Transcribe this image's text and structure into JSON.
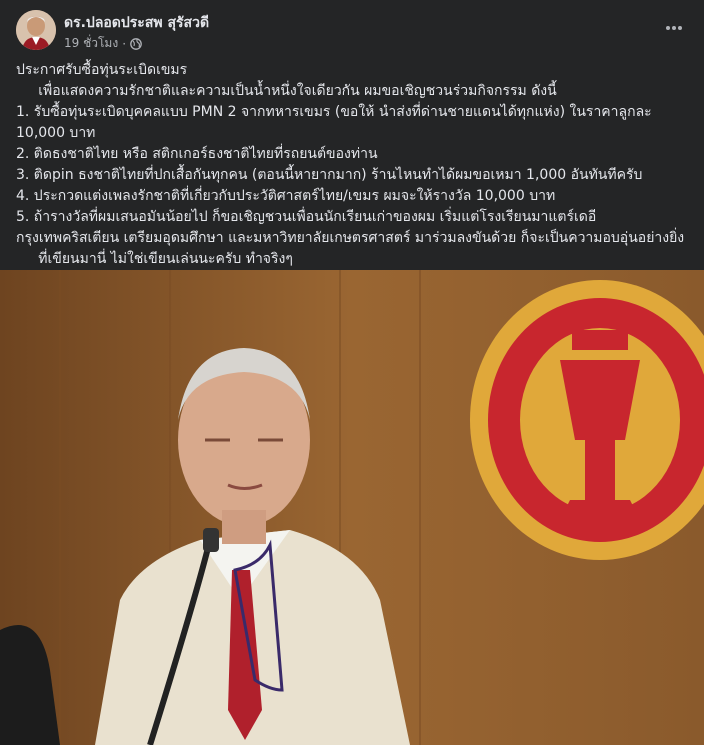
{
  "post": {
    "author": "ดร.ปลอดประสพ สุรัสวดี",
    "time": "19 ชั่วโมง",
    "separator": "·",
    "privacy_icon": "globe-icon",
    "more_icon": "ellipsis-icon",
    "lines": [
      "ประกาศรับซื้อทุ่นระเบิดเขมร",
      "     เพื่อแสดงความรักชาติและความเป็นน้ำหนึ่งใจเดียวกัน ผมขอเชิญชวนร่วมกิจกรรม ดังนี้",
      "1. รับซื้อทุ่นระเบิดบุคคลแบบ PMN 2 จากทหารเขมร (ขอให้ นำส่งที่ด่านชายแดนได้ทุกแห่ง) ในราคาลูกละ 10,000 บาท",
      "2. ติดธงชาติไทย หรือ สติกเกอร์ธงชาติไทยที่รถยนต์ของท่าน",
      "3. ติดpin ธงชาติไทยที่ปกเสื้อกันทุกคน (ตอนนี้หายากมาก) ร้านไหนทำได้ผมขอเหมา 1,000 อันทันทีครับ",
      "4. ประกวดแต่งเพลงรักชาติที่เกี่ยวกับประวัติศาสตร์ไทย/เขมร ผมจะให้รางวัล 10,000 บาท",
      "5. ถ้ารางวัลที่ผมเสนอมันน้อยไป ก็ขอเชิญชวนเพื่อนนักเรียนเก่าของผม เริ่มแต่โรงเรียนมาแตร์เดอี กรุงเทพคริสเตียน เตรียมอุดมศึกษา และมหาวิทยาลัยเกษตรศาสตร์ มาร่วมลงขันด้วย ก็จะเป็นความอบอุ่นอย่างยิ่ง",
      "     ที่เขียนมานี่ ไม่ใช่เขียนเล่นนะครับ ทำจริงๆ"
    ]
  },
  "colors": {
    "background": "#242526",
    "text": "#e4e6eb",
    "muted": "#b0b3b8",
    "wood": "#8a5a2c",
    "emblem_red": "#c8262e",
    "emblem_gold": "#e0a83a",
    "jacket": "#e9e1cf",
    "tie": "#b0202c"
  }
}
